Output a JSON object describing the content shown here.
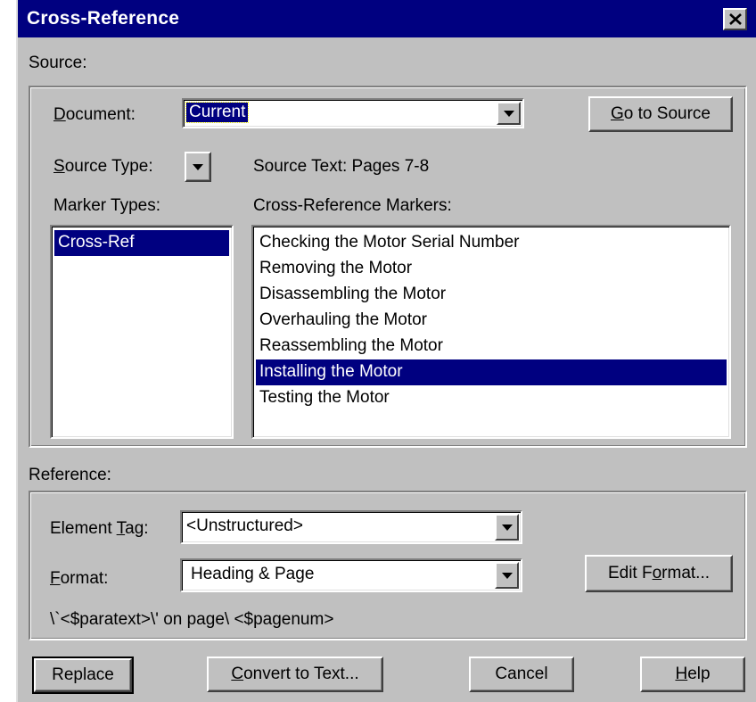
{
  "window": {
    "title": "Cross-Reference"
  },
  "source": {
    "group_label": "Source:",
    "document_label_u": "D",
    "document_label_rest": "ocument:",
    "document_value": "Current",
    "goto_source_u": "G",
    "goto_source_rest": "o to Source",
    "source_type_label_u": "S",
    "source_type_label_rest": "ource Type:",
    "source_text": "Source Text:  Pages  7-8",
    "marker_types_label": "Marker Types:",
    "marker_types": [
      {
        "label": "Cross-Ref",
        "selected": true
      }
    ],
    "markers_label": "Cross-Reference Markers:",
    "markers": [
      {
        "label": "Checking the Motor Serial Number",
        "selected": false
      },
      {
        "label": "Removing the Motor",
        "selected": false
      },
      {
        "label": "Disassembling the Motor",
        "selected": false
      },
      {
        "label": "Overhauling the Motor",
        "selected": false
      },
      {
        "label": "Reassembling the Motor",
        "selected": false
      },
      {
        "label": "Installing the Motor",
        "selected": true
      },
      {
        "label": "Testing the Motor",
        "selected": false
      }
    ]
  },
  "reference": {
    "group_label": "Reference:",
    "element_tag_label_a": "Element ",
    "element_tag_label_u": "T",
    "element_tag_label_b": "ag:",
    "element_tag_value": "<Unstructured>",
    "format_label_u": "F",
    "format_label_rest": "ormat:",
    "format_value": "Heading & Page",
    "edit_format_a": "Edit F",
    "edit_format_u": "o",
    "edit_format_b": "rmat...",
    "format_definition": "\\`<$paratext>\\' on page\\ <$pagenum>"
  },
  "buttons": {
    "replace": "Replace",
    "convert_u": "C",
    "convert_rest": "onvert to Text...",
    "cancel": "Cancel",
    "help_u": "H",
    "help_rest": "elp"
  },
  "colors": {
    "title_bar": "#000080",
    "dialog_face": "#c0c0c0",
    "selection": "#000080"
  }
}
